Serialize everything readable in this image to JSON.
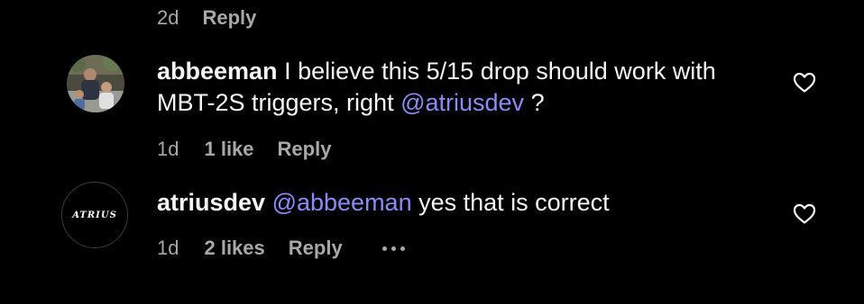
{
  "top_meta": {
    "time": "2d",
    "reply": "Reply"
  },
  "comments": [
    {
      "username": "abbeeman",
      "text_before": " I believe this 5/15 drop should work with",
      "text_line2": "MBT-2S triggers, right ",
      "mention": "@atriusdev",
      "text_after": " ?",
      "time": "1d",
      "likes": "1 like",
      "reply": "Reply",
      "icon": "heart-outline-icon"
    },
    {
      "username": "atriusdev",
      "avatar_text": "ATRIUS",
      "mention": "@abbeeman",
      "text_after": " yes that is correct",
      "time": "1d",
      "likes": "2 likes",
      "reply": "Reply",
      "icon": "heart-outline-icon",
      "more_icon": "more-options-icon"
    }
  ],
  "colors": {
    "background": "#000000",
    "text": "#f5f5f5",
    "muted": "#a8a8a8",
    "mention": "#8a8cf6"
  }
}
